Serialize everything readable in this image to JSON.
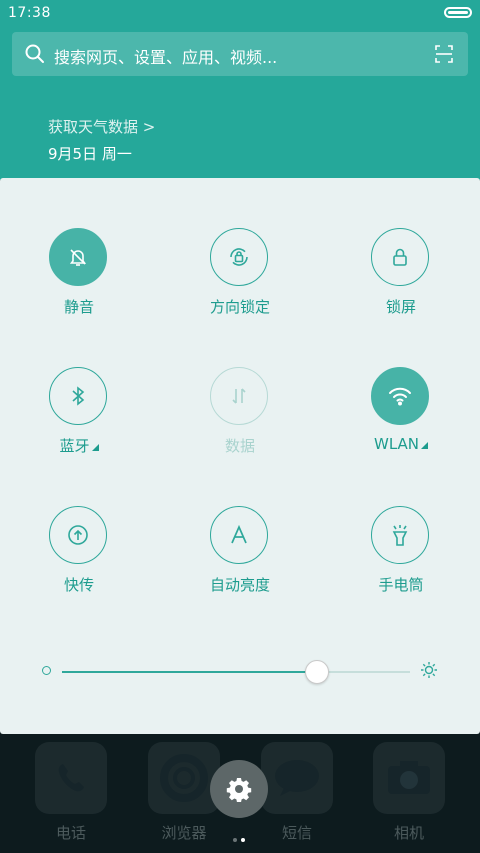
{
  "status": {
    "time": "17:38"
  },
  "search": {
    "placeholder": "搜索网页、设置、应用、视频..."
  },
  "weather": {
    "fetch_text": "获取天气数据 >",
    "date": "9月5日 周一"
  },
  "toggles": [
    {
      "label": "静音",
      "state": "on"
    },
    {
      "label": "方向锁定",
      "state": "off"
    },
    {
      "label": "锁屏",
      "state": "off"
    },
    {
      "label": "蓝牙",
      "state": "off"
    },
    {
      "label": "数据",
      "state": "disabled"
    },
    {
      "label": "WLAN",
      "state": "on"
    },
    {
      "label": "快传",
      "state": "off"
    },
    {
      "label": "自动亮度",
      "state": "off"
    },
    {
      "label": "手电筒",
      "state": "off"
    }
  ],
  "brightness": {
    "level": 0.73
  },
  "dock": {
    "apps": [
      {
        "name": "电话",
        "icon": "phone-icon"
      },
      {
        "name": "浏览器",
        "icon": "browser-icon"
      },
      {
        "name": "短信",
        "icon": "message-icon"
      },
      {
        "name": "相机",
        "icon": "camera-icon"
      }
    ],
    "page_count": 2,
    "active_page": 1
  },
  "colors": {
    "accent": "#25a89a",
    "panel_bg": "#e9f2f2",
    "toggle_on": "#47b3a7"
  }
}
